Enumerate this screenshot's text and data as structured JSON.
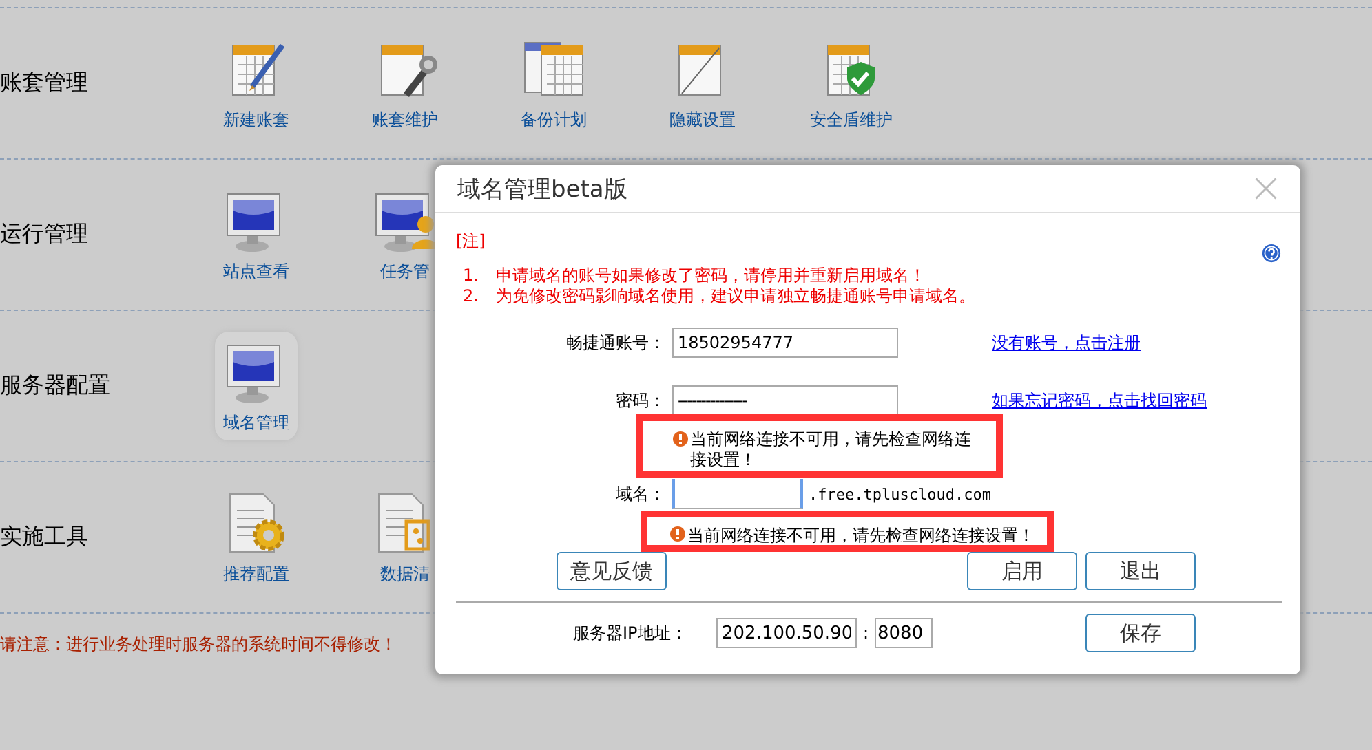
{
  "categories": [
    {
      "label": "账套管理",
      "items": [
        {
          "label": "新建账套",
          "kind": "calendar-pen"
        },
        {
          "label": "账套维护",
          "kind": "calendar-wrench"
        },
        {
          "label": "备份计划",
          "kind": "calendar-double"
        },
        {
          "label": "隐藏设置",
          "kind": "calendar-blank"
        },
        {
          "label": "安全盾维护",
          "kind": "calendar-shield"
        }
      ]
    },
    {
      "label": "运行管理",
      "items": [
        {
          "label": "站点查看",
          "kind": "monitor"
        },
        {
          "label": "任务管",
          "kind": "monitor-user"
        }
      ]
    },
    {
      "label": "服务器配置",
      "items": [
        {
          "label": "域名管理",
          "kind": "monitor",
          "selected": true
        }
      ]
    },
    {
      "label": "实施工具",
      "items": [
        {
          "label": "推荐配置",
          "kind": "doc-gear"
        },
        {
          "label": "数据清",
          "kind": "doc-clipboard"
        }
      ]
    }
  ],
  "notice": "请注意：进行业务处理时服务器的系统时间不得修改！",
  "dialog": {
    "title": "域名管理beta版",
    "note_heading": "[注]",
    "notes": [
      {
        "number": "1.",
        "text": "申请域名的账号如果修改了密码，请停用并重新启用域名！"
      },
      {
        "number": "2.",
        "text": "为免修改密码影响域名使用，建议申请独立畅捷通账号申请域名。"
      }
    ],
    "account": {
      "label": "畅捷通账号：",
      "value": "18502954777",
      "link": "没有账号，点击注册"
    },
    "password": {
      "label": "密码：",
      "value": "---------------",
      "link": "如果忘记密码，点击找回密码"
    },
    "password_error": "当前网络连接不可用，请先检查网络连接设置！",
    "domain": {
      "label": "域名：",
      "suffix": ".free.tpluscloud.com"
    },
    "domain_error": "当前网络连接不可用，请先检查网络连接设置！",
    "feedback_button": "意见反馈",
    "enable_button": "启用",
    "exit_button": "退出",
    "server": {
      "label": "服务器IP地址：",
      "ip": "202.100.50.90",
      "separator": ":",
      "port": "8080",
      "save_button": "保存"
    }
  }
}
